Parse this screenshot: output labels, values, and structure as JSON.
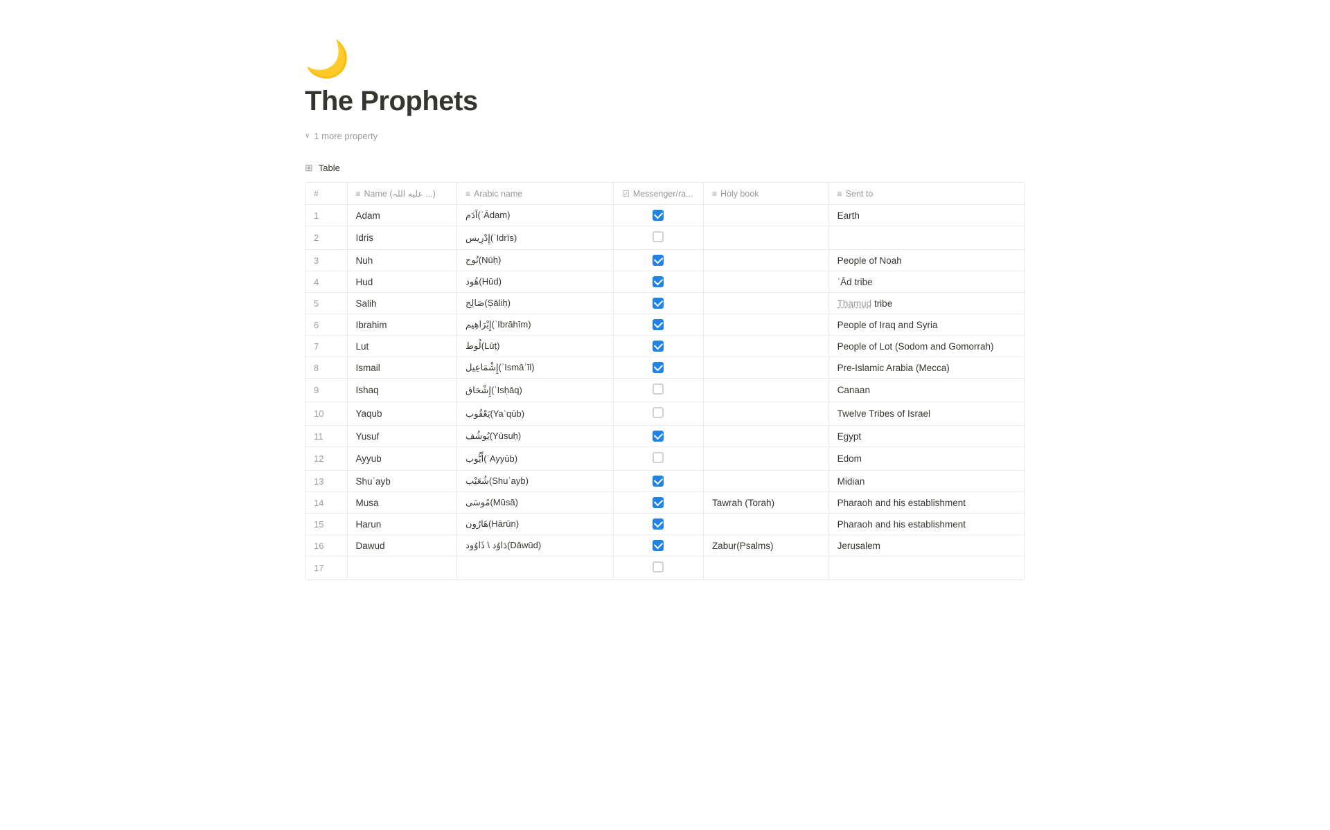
{
  "page": {
    "icon": "🌙",
    "title": "The Prophets",
    "more_property_label": "1 more property",
    "section_label": "Table"
  },
  "table": {
    "columns": [
      {
        "id": "num",
        "icon": "#",
        "label": ""
      },
      {
        "id": "name",
        "icon": "≡",
        "label": "Name (عليه الله ...)‎"
      },
      {
        "id": "arabic",
        "icon": "≡",
        "label": "Arabic name"
      },
      {
        "id": "messenger",
        "icon": "☑",
        "label": "Messenger/ra..."
      },
      {
        "id": "holy_book",
        "icon": "≡",
        "label": "Holy book"
      },
      {
        "id": "sent_to",
        "icon": "≡",
        "label": "Sent to"
      }
    ],
    "rows": [
      {
        "num": 1,
        "name": "Adam",
        "arabic": "آدَم(ʾĀdam)",
        "messenger": true,
        "holy_book": "",
        "sent_to": "Earth"
      },
      {
        "num": 2,
        "name": "Idris",
        "arabic": "إِدْرِيس(ʾIdrīs)",
        "messenger": false,
        "holy_book": "",
        "sent_to": ""
      },
      {
        "num": 3,
        "name": "Nuh",
        "arabic": "نُوح(Nūḥ)",
        "messenger": true,
        "holy_book": "",
        "sent_to": "People of Noah"
      },
      {
        "num": 4,
        "name": "Hud",
        "arabic": "هُود(Hūd)",
        "messenger": true,
        "holy_book": "",
        "sent_to": "ʿĀd tribe"
      },
      {
        "num": 5,
        "name": "Salih",
        "arabic": "صَالِح(Ṣāliḥ)",
        "messenger": true,
        "holy_book": "",
        "sent_to": "Thamud tribe"
      },
      {
        "num": 6,
        "name": "Ibrahim",
        "arabic": "إِبْرَاهِيم(ʾIbrāhīm)",
        "messenger": true,
        "holy_book": "",
        "sent_to": "People of Iraq and Syria"
      },
      {
        "num": 7,
        "name": "Lut",
        "arabic": "لُوط(Lūṭ)",
        "messenger": true,
        "holy_book": "",
        "sent_to": "People of Lot (Sodom and Gomorrah)"
      },
      {
        "num": 8,
        "name": "Ismail",
        "arabic": "إِشْمَاعِيل(ʾIsmāʾīl)",
        "messenger": true,
        "holy_book": "",
        "sent_to": "Pre-Islamic Arabia (Mecca)"
      },
      {
        "num": 9,
        "name": "Ishaq",
        "arabic": "إِشْحَاق(ʾIsḥāq)",
        "messenger": false,
        "holy_book": "",
        "sent_to": "Canaan"
      },
      {
        "num": 10,
        "name": "Yaqub",
        "arabic": "يَعْقُوب(Yaʿqūb)",
        "messenger": false,
        "holy_book": "",
        "sent_to": "Twelve Tribes of Israel"
      },
      {
        "num": 11,
        "name": "Yusuf",
        "arabic": "يُوشُف(Yūsuḥ)",
        "messenger": true,
        "holy_book": "",
        "sent_to": "Egypt"
      },
      {
        "num": 12,
        "name": "Ayyub",
        "arabic": "أَيُّوب(ʾAyyūb)",
        "messenger": false,
        "holy_book": "",
        "sent_to": "Edom"
      },
      {
        "num": 13,
        "name": "Shuʿayb",
        "arabic": "شُعَيْب(Shuʿayb)",
        "messenger": true,
        "holy_book": "",
        "sent_to": "Midian"
      },
      {
        "num": 14,
        "name": "Musa",
        "arabic": "مُوسَى(Mūsā)",
        "messenger": true,
        "holy_book": "Tawrah (Torah)",
        "sent_to": "Pharaoh and his establishment"
      },
      {
        "num": 15,
        "name": "Harun",
        "arabic": "هَارُون(Hārūn)",
        "messenger": true,
        "holy_book": "",
        "sent_to": "Pharaoh and his establishment"
      },
      {
        "num": 16,
        "name": "Dawud",
        "arabic": "دَاوُد \\ ذَاوُود(Dāwūd)",
        "messenger": true,
        "holy_book": "Zabur(Psalms)",
        "sent_to": "Jerusalem"
      },
      {
        "num": 17,
        "name": "",
        "arabic": "",
        "messenger": false,
        "holy_book": "",
        "sent_to": ""
      }
    ]
  }
}
